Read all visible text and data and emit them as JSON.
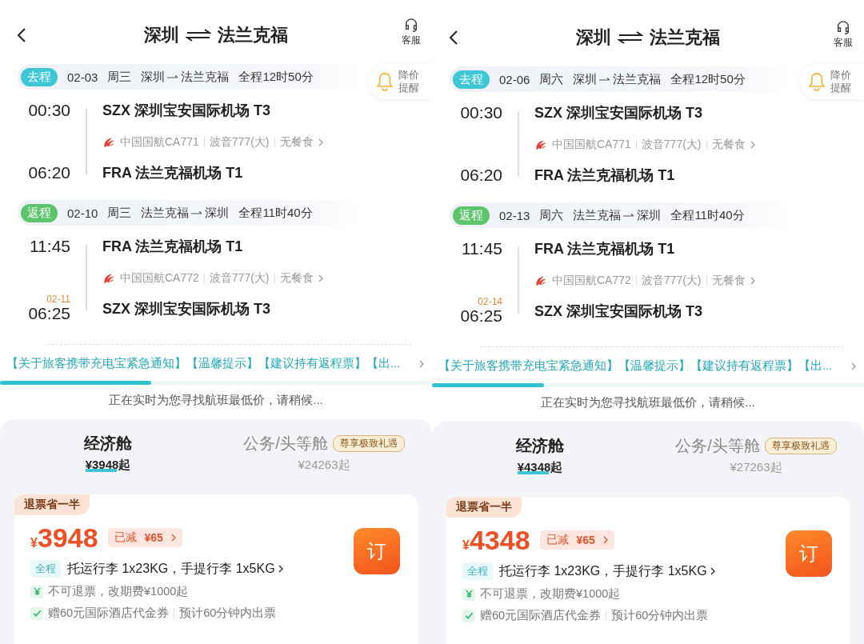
{
  "screens": [
    {
      "header": {
        "from": "深圳",
        "to": "法兰克福",
        "service": "客服"
      },
      "price_alert": [
        "降价",
        "提醒"
      ],
      "legs": [
        {
          "tag": "去程",
          "color": "#3cc6d6",
          "date": "02-03",
          "weekday": "周三",
          "from": "深圳",
          "to": "法兰克福",
          "duration": "全程12时50分",
          "dep_time": "00:30",
          "dep_airport": "SZX 深圳宝安国际机场 T3",
          "airline": "中国国航CA771",
          "aircraft": "波音777(大)",
          "meal": "无餐食",
          "arr_time": "06:20",
          "arr_airport": "FRA 法兰克福机场 T1"
        },
        {
          "tag": "返程",
          "color": "#5cc46a",
          "date": "02-10",
          "weekday": "周三",
          "from": "法兰克福",
          "to": "深圳",
          "duration": "全程11时40分",
          "dep_time": "11:45",
          "dep_airport": "FRA 法兰克福机场 T1",
          "airline": "中国国航CA772",
          "aircraft": "波音777(大)",
          "meal": "无餐食",
          "arr_next_day": "02-11",
          "arr_time": "06:25",
          "arr_airport": "SZX 深圳宝安国际机场 T3"
        }
      ],
      "notice": "【关于旅客携带充电宝紧急通知】【温馨提示】【建议持有返程票】【出...",
      "progress": {
        "level": 0.35
      },
      "searching": "正在实时为您寻找航班最低价，请稍候...",
      "cabins": [
        {
          "name": "经济舱",
          "price": "¥3948起",
          "selected": true
        },
        {
          "name": "公务/头等舱",
          "price": "¥24263起",
          "badge": "尊享极致礼遇",
          "selected": false
        }
      ],
      "fare": {
        "tag": "退票省一半",
        "currency": "¥",
        "price": "3948",
        "discount_label": "已减",
        "discount": "¥65",
        "book": "订",
        "scope": "全程",
        "baggage": "托运行李 1x23KG，手提行李 1x5KG",
        "refund": "不可退票，改期费¥1000起",
        "perks": [
          "赠60元国际酒店代金券",
          "预计60分钟内出票"
        ]
      }
    },
    {
      "header": {
        "from": "深圳",
        "to": "法兰克福",
        "service": "客服"
      },
      "price_alert": [
        "降价",
        "提醒"
      ],
      "legs": [
        {
          "tag": "去程",
          "color": "#3cc6d6",
          "date": "02-06",
          "weekday": "周六",
          "from": "深圳",
          "to": "法兰克福",
          "duration": "全程12时50分",
          "dep_time": "00:30",
          "dep_airport": "SZX 深圳宝安国际机场 T3",
          "airline": "中国国航CA771",
          "aircraft": "波音777(大)",
          "meal": "无餐食",
          "arr_time": "06:20",
          "arr_airport": "FRA 法兰克福机场 T1"
        },
        {
          "tag": "返程",
          "color": "#5cc46a",
          "date": "02-13",
          "weekday": "周六",
          "from": "法兰克福",
          "to": "深圳",
          "duration": "全程11时40分",
          "dep_time": "11:45",
          "dep_airport": "FRA 法兰克福机场 T1",
          "airline": "中国国航CA772",
          "aircraft": "波音777(大)",
          "meal": "无餐食",
          "arr_next_day": "02-14",
          "arr_time": "06:25",
          "arr_airport": "SZX 深圳宝安国际机场 T3"
        }
      ],
      "notice": "【关于旅客携带充电宝紧急通知】【温馨提示】【建议持有返程票】【出...",
      "progress": {
        "level": 0.26
      },
      "searching": "正在实时为您寻找航班最低价，请稍候...",
      "cabins": [
        {
          "name": "经济舱",
          "price": "¥4348起",
          "selected": true
        },
        {
          "name": "公务/头等舱",
          "price": "¥27263起",
          "badge": "尊享极致礼遇",
          "selected": false
        }
      ],
      "fare": {
        "tag": "退票省一半",
        "currency": "¥",
        "price": "4348",
        "discount_label": "已减",
        "discount": "¥65",
        "book": "订",
        "scope": "全程",
        "baggage": "托运行李 1x23KG，手提行李 1x5KG",
        "refund": "不可退票，改期费¥1000起",
        "perks": [
          "赠60元国际酒店代金券",
          "预计60分钟内出票"
        ]
      }
    }
  ]
}
